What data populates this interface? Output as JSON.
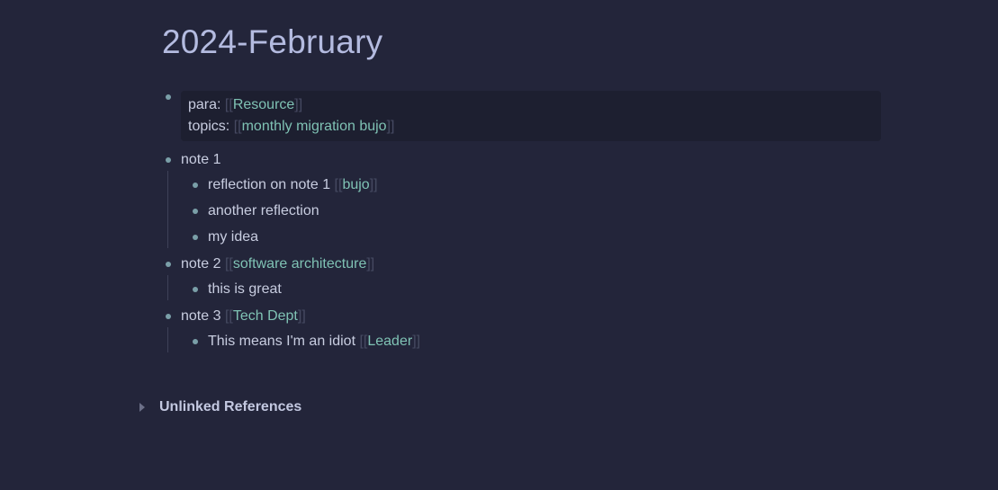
{
  "page": {
    "title": "2024-February"
  },
  "properties": {
    "para_label": "para:",
    "para_ref": "Resource",
    "topics_label": "topics:",
    "topics_ref": "monthly migration bujo"
  },
  "brackets": {
    "open": "[[",
    "close": "]]"
  },
  "blocks": {
    "note1": {
      "text": "note 1",
      "children": {
        "c1_text": "reflection on note 1",
        "c1_ref": "bujo",
        "c2_text": "another reflection",
        "c3_text": "my idea"
      }
    },
    "note2": {
      "text": "note 2",
      "ref": "software architecture",
      "children": {
        "c1_text": "this is great"
      }
    },
    "note3": {
      "text": "note 3",
      "ref": "Tech Dept",
      "children": {
        "c1_text": "This means I'm an idiot",
        "c1_ref": "Leader"
      }
    }
  },
  "references": {
    "unlinked_label": "Unlinked References"
  },
  "colors": {
    "background": "#23253a",
    "title": "#b4bbe0",
    "link": "#7fc2b4",
    "bullet": "#7a9fa8",
    "property_box": "#1d1f30"
  }
}
